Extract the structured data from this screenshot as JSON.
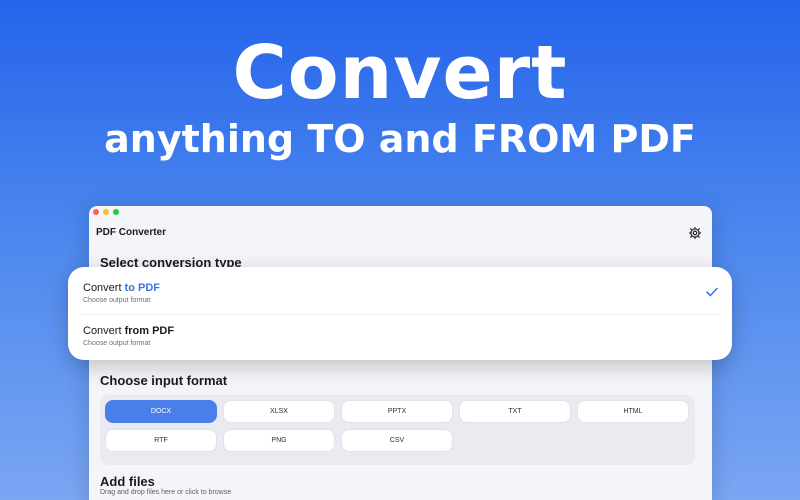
{
  "hero": {
    "title": "Convert",
    "subtitle": "anything TO and FROM PDF"
  },
  "window": {
    "title": "PDF Converter",
    "settings_icon": "gear-icon"
  },
  "conversion": {
    "heading": "Select conversion type",
    "options": [
      {
        "prefix": "Convert ",
        "emphasis": "to PDF",
        "description": "Choose output format",
        "selected": true
      },
      {
        "prefix": "Convert ",
        "emphasis": "from PDF",
        "description": "Choose output format",
        "selected": false
      }
    ],
    "check_icon": "checkmark-icon",
    "accent_color": "#3b74e3"
  },
  "input_format": {
    "heading": "Choose input format",
    "formats": [
      "DOCX",
      "XLSX",
      "PPTX",
      "TXT",
      "HTML",
      "RTF",
      "PNG",
      "CSV"
    ],
    "selected": "DOCX",
    "selected_color": "#4a7ee8"
  },
  "files": {
    "heading": "Add files",
    "description": "Drag and drop files here or click to browse"
  }
}
